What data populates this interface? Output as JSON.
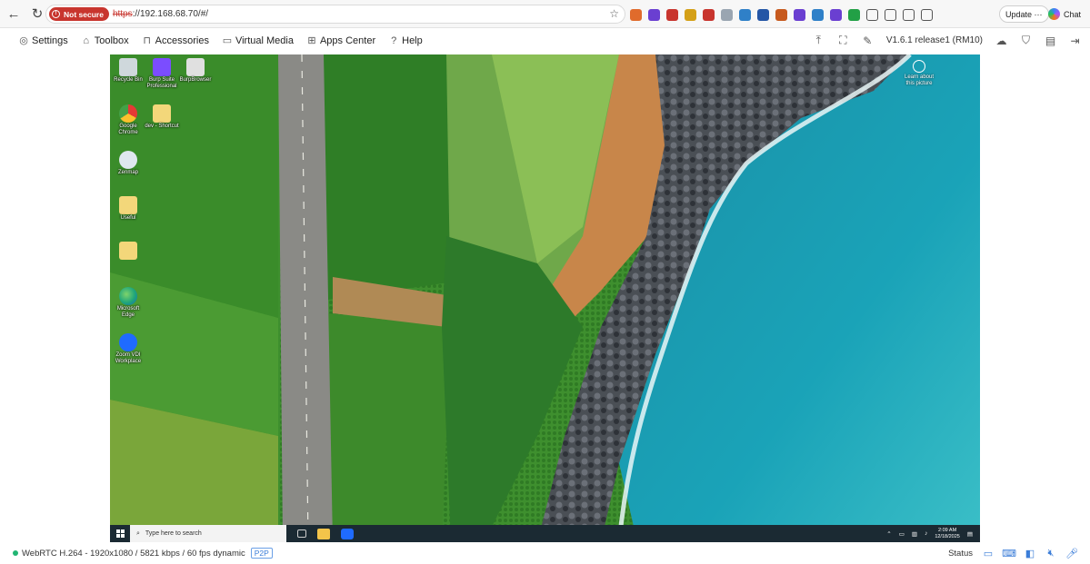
{
  "browser": {
    "not_secure_label": "Not secure",
    "url_scheme": "https",
    "url_rest": "://192.168.68.70/#/",
    "update_label": "Update",
    "update_more": "···",
    "chat_label": "Chat",
    "extension_colors": [
      "#e06b2c",
      "#6a3fd1",
      "#c8352e",
      "#d4a017",
      "#c8352e",
      "#9aa5b1",
      "#2f80c8",
      "#2456a6",
      "#c75a1e",
      "#6a3fd1",
      "#2f80c8",
      "#6a3fd1",
      "#22a046"
    ]
  },
  "kvm": {
    "menu": [
      {
        "label": "Settings",
        "icon": "gear-icon",
        "glyph": "◎"
      },
      {
        "label": "Toolbox",
        "icon": "toolbox-icon",
        "glyph": "⌂"
      },
      {
        "label": "Accessories",
        "icon": "bag-icon",
        "glyph": "⊓"
      },
      {
        "label": "Virtual Media",
        "icon": "monitor-icon",
        "glyph": "▭"
      },
      {
        "label": "Apps Center",
        "icon": "apps-grid-icon",
        "glyph": "⊞"
      },
      {
        "label": "Help",
        "icon": "help-icon",
        "glyph": "?"
      }
    ],
    "version": "V1.6.1 release1 (RM10)"
  },
  "desktop": {
    "icons": [
      {
        "label": "Recycle Bin",
        "color": "#cfd8dc"
      },
      {
        "label": "Burp Suite Professional",
        "color": "#7b4dff"
      },
      {
        "label": "BurpBrowser",
        "color": "#e0e0e0"
      },
      {
        "label": "Google Chrome",
        "color": "#f2c230"
      },
      {
        "label": "dev - Shortcut",
        "color": "#f3d77a"
      },
      {
        "label": "Zenmap",
        "color": "#dfe7ef"
      },
      {
        "label": "Useful",
        "color": "#f3d77a"
      },
      {
        "label": "",
        "color": "#f3d77a"
      },
      {
        "label": "Microsoft Edge",
        "color": "#1fa67a"
      },
      {
        "label": "Zoom VDI Workplace",
        "color": "#1f6bff"
      }
    ],
    "learn_label": "Learn about this picture",
    "taskbar": {
      "search_placeholder": "Type here to search",
      "time": "2:09 AM",
      "date": "12/18/2025"
    }
  },
  "status": {
    "stream_info": "WebRTC H.264 - 1920x1080 /  5821 kbps / 60 fps dynamic",
    "p2p_label": "P2P",
    "status_label": "Status"
  }
}
